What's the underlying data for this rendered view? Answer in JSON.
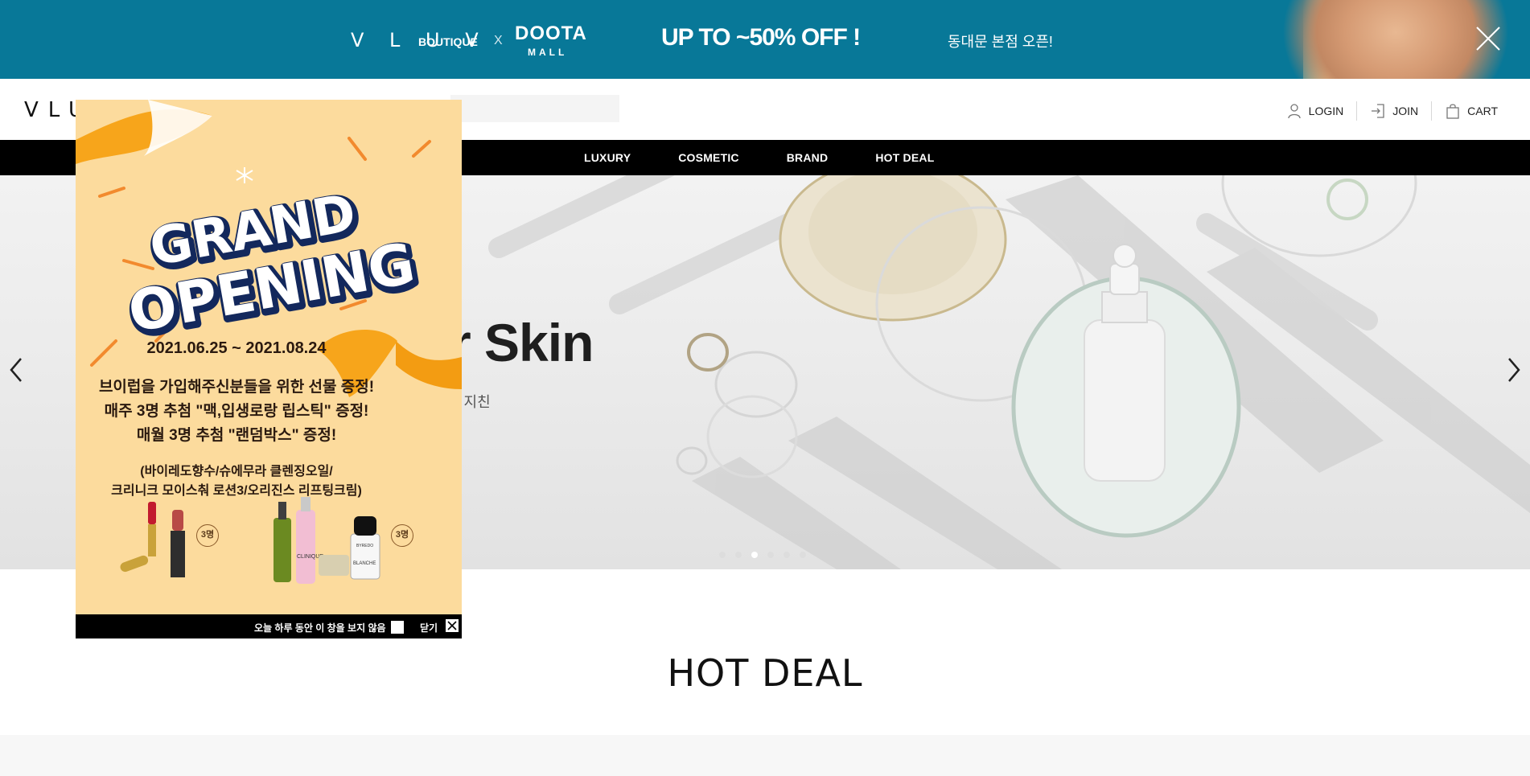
{
  "promo_banner": {
    "vluv": "V L U V",
    "boutique": "BOUTIQUE",
    "x": "X",
    "doota": "DOOTA",
    "mall": "MALL",
    "sale": "UP TO ~50% OFF !",
    "opening": "동대문 본점 오픈!",
    "bg_color": "#087898"
  },
  "header": {
    "logo": "VLU",
    "account": {
      "login": "LOGIN",
      "join": "JOIN",
      "cart": "CART"
    }
  },
  "nav": {
    "items": [
      "LUXURY",
      "COSMETIC",
      "BRAND",
      "HOT DEAL"
    ]
  },
  "hero": {
    "title": "r Skin",
    "subtitle": "세 지친",
    "slides": 6,
    "active_slide": 3
  },
  "popup": {
    "headline_1": "GRAND",
    "headline_2": "OPENING",
    "date": "2021.06.25 ~ 2021.08.24",
    "line_1": "브이럽을 가입해주신분들을 위한 선물 증정!",
    "line_2": "매주 3명 추첨  \"맥,입생로랑 립스틱\" 증정!",
    "line_3": "매월 3명 추첨 \"랜덤박스\" 증정!",
    "line_4": "(바이레도향수/슈에무라 클렌징오일/",
    "line_5": "크리니크 모이스춰 로션3/오리진스 리프팅크림)",
    "badge": "3명",
    "brand_clinique": "CLINIQUE",
    "brand_blanche": "BLANCHE",
    "brand_byredo": "BYREDO",
    "not_today": "오늘 하루 동안 이 창을 보지 않음",
    "close": "닫기",
    "bg_color": "#fcdb9d"
  },
  "section": {
    "hot_deal_title": "HOT DEAL"
  }
}
